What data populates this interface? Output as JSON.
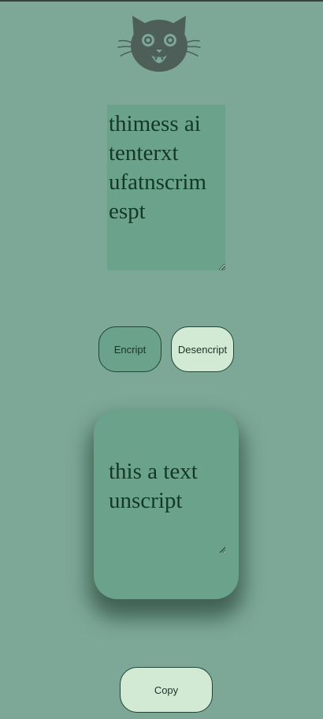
{
  "header": {
    "logo_icon": "cat-face-icon"
  },
  "input": {
    "value": "thimess ai tenterxt ufatnscrim espt"
  },
  "actions": {
    "encrypt_label": "Encript",
    "decrypt_label": "Desencript"
  },
  "output": {
    "value": "this a text unscript"
  },
  "copy": {
    "label": "Copy"
  },
  "colors": {
    "background": "#7da898",
    "field": "#6ba28c",
    "light_button": "#d2ead3",
    "text": "#133826",
    "logo": "#4e5e58"
  }
}
